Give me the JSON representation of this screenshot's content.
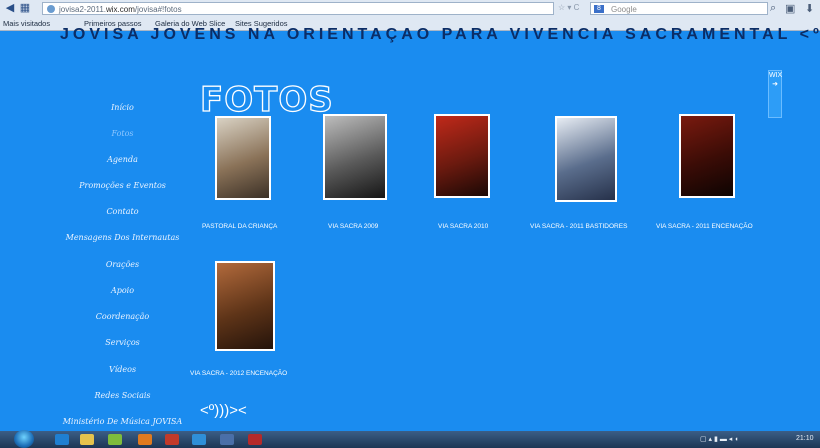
{
  "browser": {
    "url_prefix": "jovisa2-2011.",
    "url_domain": "wix.com",
    "url_path": "/jovisa#!fotos",
    "search_placeholder": "Google",
    "search_engine_letter": "8",
    "bookmarks": [
      "Mais visitados",
      "Primeiros passos",
      "Galeria do Web Slice",
      "Sites Sugeridos"
    ]
  },
  "header": {
    "title": "JOVISA  JOVENS NA ORIENTAÇÃO PARA VIVÊNCIA SACRAMENTAL  <º)))>< "
  },
  "sidebar": {
    "items": [
      {
        "label": "Início"
      },
      {
        "label": "Fotos"
      },
      {
        "label": "Agenda"
      },
      {
        "label": "Promoções e Eventos"
      },
      {
        "label": "Contato"
      },
      {
        "label": "Mensagens Dos Internautas"
      },
      {
        "label": "Orações"
      },
      {
        "label": "Apoio"
      },
      {
        "label": "Coordenação"
      },
      {
        "label": "Serviços"
      },
      {
        "label": "Vídeos"
      },
      {
        "label": "Redes Sociais"
      },
      {
        "label": "Ministério De Música JOVISA"
      }
    ]
  },
  "main": {
    "page_title": "FOTOS",
    "albums": [
      {
        "label": "PASTORAL DA CRIANÇA",
        "palette": [
          "#d9d2c4",
          "#8a7258",
          "#3b3026"
        ]
      },
      {
        "label": "VIA SACRA 2009",
        "palette": [
          "#bdbdbd",
          "#5a5a5a",
          "#151515"
        ]
      },
      {
        "label": "VIA SACRA 2010",
        "palette": [
          "#c0291a",
          "#6b1a0f",
          "#1a0805"
        ]
      },
      {
        "label": "VIA SACRA - 2011 BASTIDORES",
        "palette": [
          "#e7ecf3",
          "#5a6d8c",
          "#26314a"
        ]
      },
      {
        "label": "VIA SACRA - 2011 ENCENAÇÃO",
        "palette": [
          "#7a1a0f",
          "#3a0c06",
          "#0d0402"
        ]
      },
      {
        "label": "VIA SACRA - 2012 ENCENAÇÃO",
        "palette": [
          "#b26a3c",
          "#5e3418",
          "#24130a"
        ]
      }
    ],
    "emoticon": "<º)))><"
  },
  "widget": {
    "label": "WIX",
    "arrow": "➜"
  },
  "taskbar": {
    "clock": "21:10"
  }
}
